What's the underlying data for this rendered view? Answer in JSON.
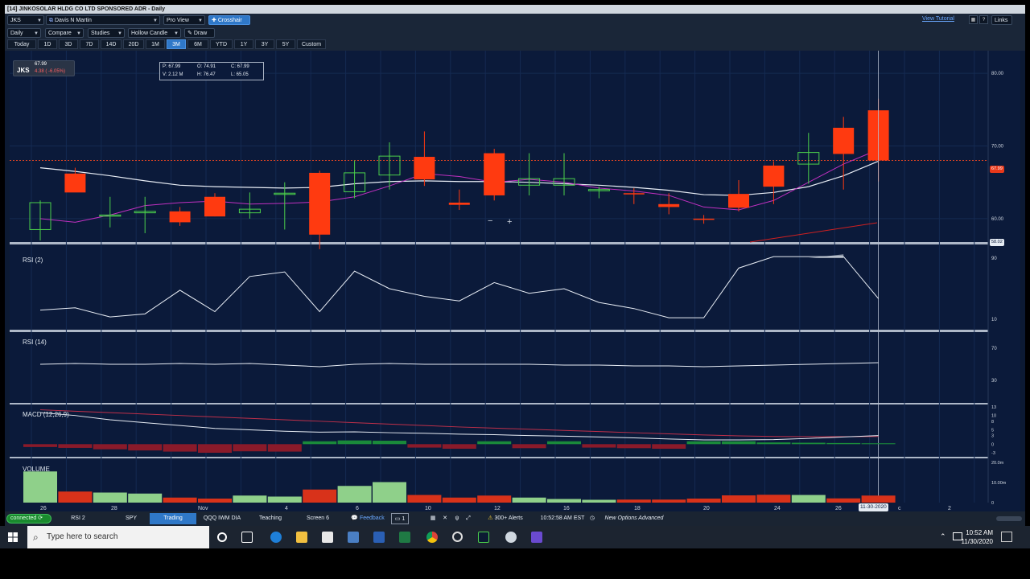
{
  "window": {
    "title": "[14] JINKOSOLAR HLDG CO LTD SPONSORED ADR - Daily"
  },
  "toolbar1": {
    "symbol": "JKS",
    "account": "Davis N Martin",
    "view": "Pro View",
    "crosshair": "Crosshair",
    "view_tutorial": "View Tutorial",
    "links": "Links"
  },
  "toolbar2": {
    "period": "Daily",
    "compare": "Compare",
    "studies": "Studies",
    "style": "Hollow Candle",
    "draw": "Draw"
  },
  "ranges": [
    "Today",
    "1D",
    "3D",
    "7D",
    "14D",
    "20D",
    "1M",
    "3M",
    "6M",
    "YTD",
    "1Y",
    "3Y",
    "5Y",
    "Custom"
  ],
  "ranges_active": "3M",
  "symbol_box": {
    "symbol": "JKS",
    "price": "67.99",
    "change": "4.38 ( -6.05%)"
  },
  "ohlc": {
    "p": "P: 67.99",
    "o": "O: 74.91",
    "c": "C: 67.99",
    "v": "V: 2.12 M",
    "h": "H: 76.47",
    "l": "L: 65.05"
  },
  "panels": {
    "rsi2": "RSI (2)",
    "rsi14": "RSI (14)",
    "macd": "MACD (12,26,9)",
    "volume": "VOLUME"
  },
  "price_axis": [
    "80.00",
    "70.00",
    "60.00"
  ],
  "price_tag_last": "67.99",
  "price_tag_cursor": "58.02",
  "rsi2_axis": [
    "90",
    "10"
  ],
  "rsi14_axis": [
    "70",
    "30"
  ],
  "macd_axis": [
    "13",
    "10",
    "8",
    "5",
    "3",
    "0",
    "-3"
  ],
  "volume_axis": [
    "20.0m",
    "10.00m",
    "0"
  ],
  "x_axis": [
    "26",
    "28",
    "Nov",
    "4",
    "6",
    "10",
    "12",
    "16",
    "18",
    "20",
    "24",
    "26",
    "c",
    "2"
  ],
  "x_cursor_date": "11-30-2020",
  "statusbar": {
    "connected": "connected",
    "tabs": [
      "RSI 2",
      "SPY",
      "Trading",
      "QQQ IWM DIA",
      "Teaching",
      "Screen 6"
    ],
    "active_tab": "Trading",
    "feedback": "Feedback",
    "screen_count": "1",
    "alerts": "300+ Alerts",
    "time": "10:52:58 AM EST",
    "news": "New Options Advanced"
  },
  "taskbar": {
    "search_placeholder": "Type here to search",
    "time": "10:52 AM",
    "date": "11/30/2020"
  },
  "colors": {
    "up": "#4bd04b",
    "down": "#ff3a10",
    "background": "#0b1a3a",
    "accent": "#2f78c8"
  },
  "chart_data": {
    "type": "candlestick",
    "x": [
      "10-26",
      "10-27",
      "10-28",
      "10-29",
      "10-30",
      "11-02",
      "11-03",
      "11-04",
      "11-05",
      "11-06",
      "11-09",
      "11-10",
      "11-11",
      "11-12",
      "11-13",
      "11-16",
      "11-17",
      "11-18",
      "11-19",
      "11-20",
      "11-23",
      "11-24",
      "11-25",
      "11-27",
      "11-30"
    ],
    "open": [
      58.5,
      66.2,
      60.5,
      60.8,
      61.0,
      63.0,
      60.8,
      63.5,
      66.3,
      63.7,
      66.0,
      68.5,
      62.2,
      69.0,
      64.6,
      64.6,
      64.0,
      63.5,
      62.0,
      60.0,
      63.4,
      67.3,
      67.5,
      72.5,
      74.9
    ],
    "high": [
      62.5,
      67.0,
      63.0,
      63.0,
      61.6,
      63.5,
      63.6,
      65.0,
      66.6,
      68.0,
      70.5,
      72.0,
      64.0,
      69.6,
      69.0,
      69.0,
      64.4,
      64.2,
      63.5,
      60.5,
      65.3,
      67.9,
      71.8,
      74.0,
      76.5
    ],
    "low": [
      57.0,
      64.0,
      58.8,
      58.0,
      59.0,
      60.3,
      60.0,
      58.5,
      55.8,
      62.8,
      64.0,
      64.5,
      61.2,
      62.5,
      63.2,
      63.2,
      62.8,
      62.0,
      60.6,
      59.3,
      61.0,
      62.0,
      64.8,
      64.0,
      65.1
    ],
    "close": [
      62.2,
      63.6,
      60.5,
      61.0,
      59.5,
      60.3,
      61.3,
      63.5,
      57.8,
      66.3,
      68.6,
      65.4,
      61.9,
      63.2,
      65.5,
      65.5,
      64.0,
      63.4,
      61.6,
      59.9,
      61.5,
      64.4,
      69.1,
      68.9,
      68.0
    ],
    "ylim": [
      57,
      82
    ],
    "rsi2": [
      22,
      25,
      13,
      17,
      48,
      20,
      66,
      72,
      20,
      73,
      50,
      40,
      34,
      58,
      44,
      50,
      32,
      24,
      12,
      12,
      77,
      94,
      94,
      95,
      37
    ],
    "rsi14": [
      50,
      51,
      50,
      50,
      51,
      50,
      51,
      49,
      47,
      50,
      51,
      50,
      50,
      50,
      50,
      49,
      49,
      48,
      48,
      47,
      48,
      49,
      50,
      51,
      52
    ],
    "macd_line": [
      11,
      10,
      8.5,
      7.5,
      6.5,
      5.5,
      5,
      4.5,
      4.2,
      4.3,
      4,
      3.8,
      3.5,
      3.3,
      3,
      2.8,
      2.5,
      2.2,
      1.8,
      1.5,
      1.5,
      1.6,
      2,
      2.5,
      3
    ],
    "macd_signal": [
      12,
      11.5,
      11,
      10.5,
      10,
      9.5,
      9,
      8.5,
      8,
      7.5,
      7,
      6.5,
      6,
      5.6,
      5.2,
      4.8,
      4.4,
      4,
      3.6,
      3.2,
      2.9,
      2.7,
      2.6,
      2.6,
      2.7
    ],
    "macd_hist": [
      -1,
      -1.3,
      -1.8,
      -2.2,
      -2.6,
      -3,
      -2.5,
      -2.6,
      1,
      1.3,
      1.2,
      -1.2,
      -1.6,
      1,
      -1.4,
      1,
      -1.2,
      -1.4,
      -1.6,
      1,
      1,
      0.6,
      0.5,
      0.4,
      0.3
    ],
    "volume": [
      15.5,
      5.5,
      5,
      4.5,
      2.5,
      2,
      3.5,
      3,
      6.5,
      8.3,
      10.2,
      3.8,
      2.5,
      3.5,
      2.5,
      1.8,
      1.4,
      1.5,
      1.5,
      2.0,
      3.6,
      3.9,
      3.8,
      2.1,
      3.5
    ],
    "ma_fast": [
      60,
      59.5,
      60.5,
      61.8,
      62.2,
      62.4,
      62.0,
      62.1,
      62.3,
      63.0,
      64.5,
      66.2,
      65.8,
      65.0,
      65.4,
      65.0,
      64.2,
      63.8,
      63.2,
      61.6,
      61.2,
      62.5,
      65,
      67.5,
      69.5
    ],
    "ma_slow": [
      67,
      66.5,
      65.9,
      65.2,
      64.6,
      64.4,
      64.3,
      64.2,
      64.3,
      64.8,
      65.1,
      65.2,
      65.1,
      65.1,
      65.0,
      64.8,
      64.6,
      64.3,
      63.9,
      63.3,
      63.2,
      63.6,
      64.4,
      65.9,
      67.9
    ]
  }
}
